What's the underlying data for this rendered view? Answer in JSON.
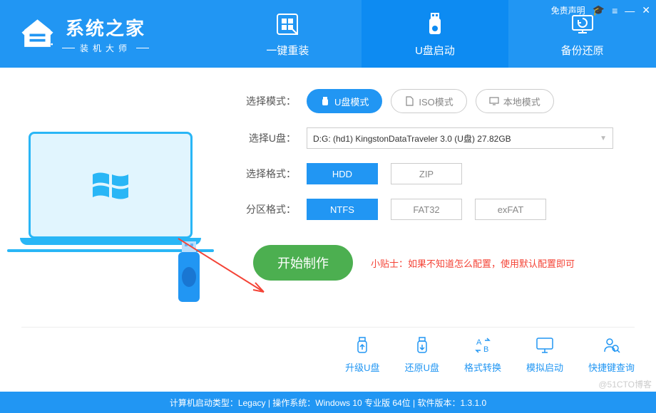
{
  "logo": {
    "title": "系统之家",
    "subtitle": "装机大师"
  },
  "topRight": {
    "disclaimer": "免责声明"
  },
  "nav": {
    "items": [
      {
        "label": "一键重装"
      },
      {
        "label": "U盘启动"
      },
      {
        "label": "备份还原"
      }
    ]
  },
  "form": {
    "modeLabel": "选择模式：",
    "modes": [
      {
        "label": "U盘模式"
      },
      {
        "label": "ISO模式"
      },
      {
        "label": "本地模式"
      }
    ],
    "usbLabel": "选择U盘：",
    "usbValue": "D:G: (hd1) KingstonDataTraveler 3.0 (U盘) 27.82GB",
    "fmtLabel": "选择格式：",
    "fmts": [
      {
        "label": "HDD"
      },
      {
        "label": "ZIP"
      }
    ],
    "partLabel": "分区格式：",
    "parts": [
      {
        "label": "NTFS"
      },
      {
        "label": "FAT32"
      },
      {
        "label": "exFAT"
      }
    ],
    "startLabel": "开始制作",
    "tipPrefix": "小贴士：",
    "tipText": "如果不知道怎么配置，使用默认配置即可"
  },
  "tools": [
    {
      "label": "升级U盘"
    },
    {
      "label": "还原U盘"
    },
    {
      "label": "格式转换"
    },
    {
      "label": "模拟启动"
    },
    {
      "label": "快捷键查询"
    }
  ],
  "status": "计算机启动类型：Legacy | 操作系统：Windows 10 专业版 64位 | 软件版本：1.3.1.0",
  "watermark": "@51CTO博客"
}
